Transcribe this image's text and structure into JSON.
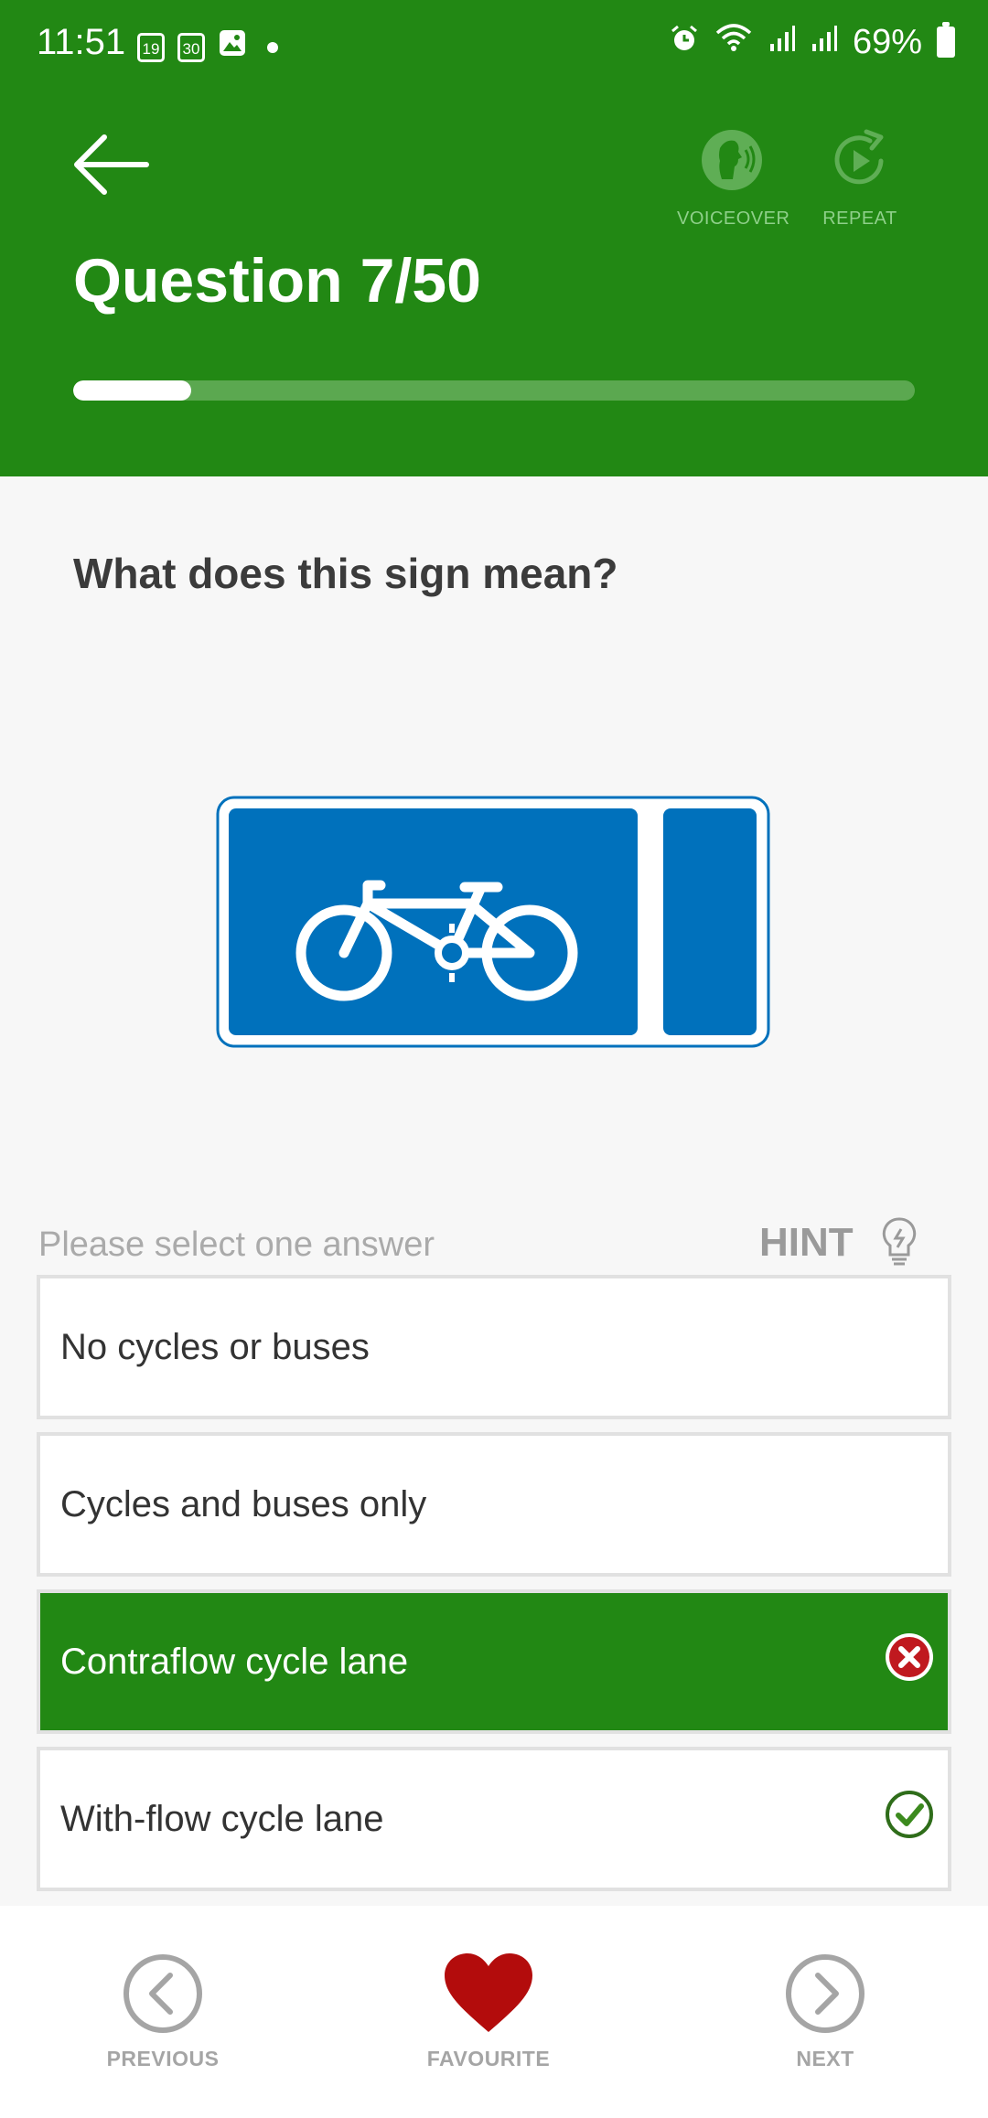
{
  "status_bar": {
    "time": "11:51",
    "calendar_day_1": "19",
    "calendar_day_2": "30",
    "battery": "69%"
  },
  "header": {
    "voiceover_label": "VOICEOVER",
    "repeat_label": "REPEAT",
    "title": "Question 7/50",
    "progress_fraction": 0.14
  },
  "question": {
    "prompt": "What does this sign mean?",
    "sign_icon": "bicycle-lane-sign"
  },
  "answers_section": {
    "instruction": "Please select one answer",
    "hint_label": "HINT"
  },
  "answers": [
    {
      "label": "No cycles or buses",
      "state": "none"
    },
    {
      "label": "Cycles and buses only",
      "state": "none"
    },
    {
      "label": "Contraflow cycle lane",
      "state": "selected-wrong"
    },
    {
      "label": "With-flow cycle lane",
      "state": "correct"
    }
  ],
  "bottom_nav": {
    "previous_label": "PREVIOUS",
    "favourite_label": "FAVOURITE",
    "next_label": "NEXT"
  },
  "colors": {
    "header_green": "#228814",
    "sign_blue": "#0071bc",
    "heart_red": "#b30c0c",
    "wrong_red": "#c0191f",
    "correct_green": "#3c8a1e"
  }
}
